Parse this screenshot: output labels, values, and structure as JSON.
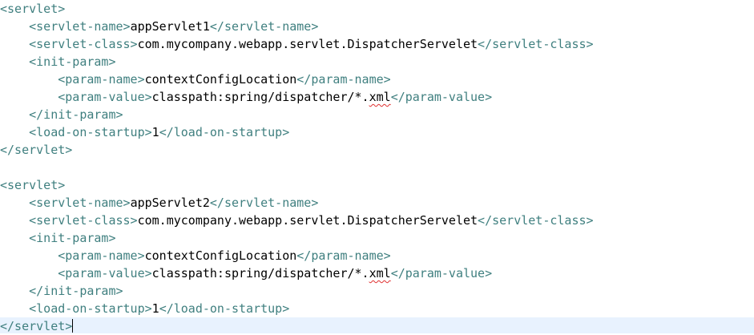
{
  "editor": {
    "lines": [
      {
        "indent": "",
        "open": "<servlet>",
        "text": "",
        "close": "",
        "squiggle": "",
        "after": ""
      },
      {
        "indent": "    ",
        "open": "<servlet-name>",
        "text": "appServlet1",
        "close": "</servlet-name>",
        "squiggle": "",
        "after": ""
      },
      {
        "indent": "    ",
        "open": "<servlet-class>",
        "text": "com.mycompany.webapp.servlet.DispatcherServelet",
        "close": "</servlet-class>",
        "squiggle": "",
        "after": ""
      },
      {
        "indent": "    ",
        "open": "<init-param>",
        "text": "",
        "close": "",
        "squiggle": "",
        "after": ""
      },
      {
        "indent": "        ",
        "open": "<param-name>",
        "text": "contextConfigLocation",
        "close": "</param-name>",
        "squiggle": "",
        "after": ""
      },
      {
        "indent": "        ",
        "open": "<param-value>",
        "text": "classpath:spring/dispatcher/*.",
        "squiggle": "xml",
        "close": "</param-value>",
        "after": ""
      },
      {
        "indent": "    ",
        "open": "</init-param>",
        "text": "",
        "close": "",
        "squiggle": "",
        "after": ""
      },
      {
        "indent": "    ",
        "open": "<load-on-startup>",
        "text": "1",
        "close": "</load-on-startup>",
        "squiggle": "",
        "after": ""
      },
      {
        "indent": "",
        "open": "</servlet>",
        "text": "",
        "close": "",
        "squiggle": "",
        "after": ""
      },
      {
        "indent": "",
        "open": "",
        "text": "",
        "close": "",
        "squiggle": "",
        "after": ""
      },
      {
        "indent": "",
        "open": "<servlet>",
        "text": "",
        "close": "",
        "squiggle": "",
        "after": ""
      },
      {
        "indent": "    ",
        "open": "<servlet-name>",
        "text": "appServlet2",
        "close": "</servlet-name>",
        "squiggle": "",
        "after": ""
      },
      {
        "indent": "    ",
        "open": "<servlet-class>",
        "text": "com.mycompany.webapp.servlet.DispatcherServelet",
        "close": "</servlet-class>",
        "squiggle": "",
        "after": ""
      },
      {
        "indent": "    ",
        "open": "<init-param>",
        "text": "",
        "close": "",
        "squiggle": "",
        "after": ""
      },
      {
        "indent": "        ",
        "open": "<param-name>",
        "text": "contextConfigLocation",
        "close": "</param-name>",
        "squiggle": "",
        "after": ""
      },
      {
        "indent": "        ",
        "open": "<param-value>",
        "text": "classpath:spring/dispatcher/*.",
        "squiggle": "xml",
        "close": "</param-value>",
        "after": ""
      },
      {
        "indent": "    ",
        "open": "</init-param>",
        "text": "",
        "close": "",
        "squiggle": "",
        "after": ""
      },
      {
        "indent": "    ",
        "open": "<load-on-startup>",
        "text": "1",
        "close": "</load-on-startup>",
        "squiggle": "",
        "after": ""
      },
      {
        "indent": "",
        "open": "</servlet>",
        "text": "",
        "close": "",
        "squiggle": "",
        "after": ""
      }
    ],
    "current_line_index": 18,
    "colors": {
      "tag": "#3f7f7f",
      "text": "#000000",
      "current_line_highlight": "#e8f2fe",
      "spelling_squiggle": "#e03030"
    }
  }
}
